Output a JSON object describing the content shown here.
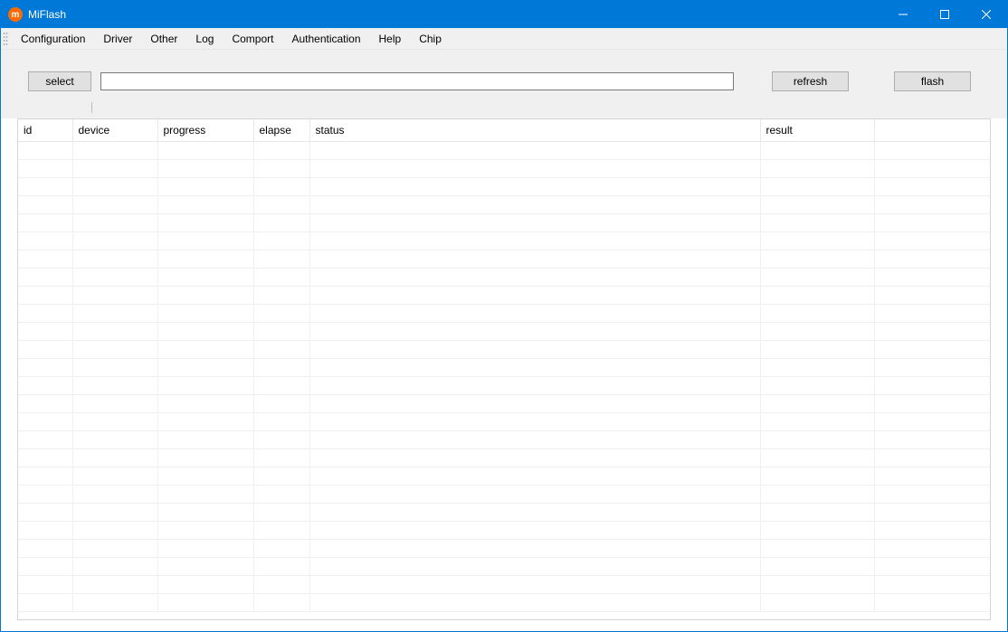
{
  "window": {
    "title": "MiFlash",
    "app_icon_glyph": "m"
  },
  "menubar": {
    "items": [
      "Configuration",
      "Driver",
      "Other",
      "Log",
      "Comport",
      "Authentication",
      "Help",
      "Chip"
    ]
  },
  "toolbar": {
    "select_label": "select",
    "path_value": "",
    "refresh_label": "refresh",
    "flash_label": "flash"
  },
  "table": {
    "columns": [
      "id",
      "device",
      "progress",
      "elapse",
      "status",
      "result",
      ""
    ],
    "rows": 26
  }
}
